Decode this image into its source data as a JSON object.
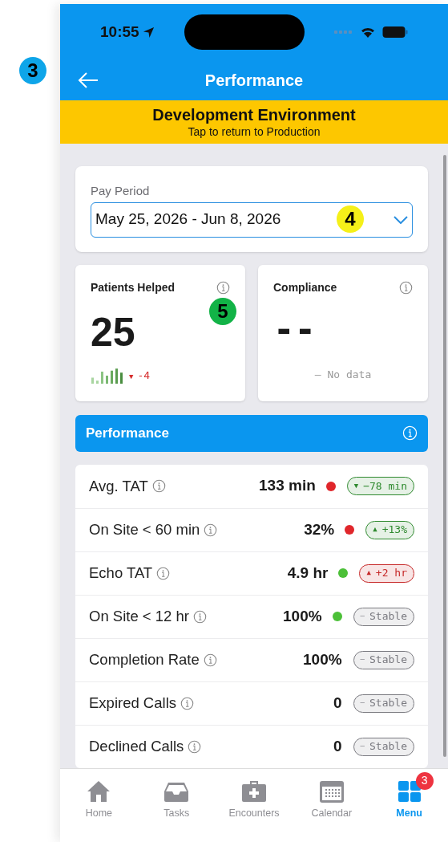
{
  "callouts": [
    {
      "label": "3",
      "color": "#0ea5e9"
    },
    {
      "label": "4",
      "color": "#f5f019"
    },
    {
      "label": "5",
      "color": "#12b347"
    }
  ],
  "status_bar": {
    "time": "10:55"
  },
  "header": {
    "title": "Performance"
  },
  "env_banner": {
    "title": "Development Environment",
    "subtitle": "Tap to return to Production"
  },
  "pay_period": {
    "label": "Pay Period",
    "value": "May 25, 2026 - Jun 8, 2026"
  },
  "stat_cards": [
    {
      "kind": "trend",
      "title": "Patients Helped",
      "value": "25",
      "change": "-4"
    },
    {
      "kind": "empty",
      "title": "Compliance",
      "value": "--",
      "note": "– No data"
    }
  ],
  "section": {
    "title": "Performance"
  },
  "metrics": [
    {
      "label": "Avg. TAT",
      "value": "133 min",
      "color": "#e0262b",
      "trend": {
        "color": "#2f8a2f",
        "arrow": "▼",
        "text": "−78 min"
      }
    },
    {
      "label": "On Site < 60 min",
      "value": "32%",
      "color": "#e0262b",
      "trend": {
        "color": "#2f8a2f",
        "arrow": "▲",
        "text": "+13%"
      }
    },
    {
      "label": "Echo TAT",
      "value": "4.9 hr",
      "color": "#4cc038",
      "trend": {
        "color": "#c62828",
        "arrow": "▲",
        "text": "+2 hr"
      }
    },
    {
      "label": "On Site < 12 hr",
      "value": "100%",
      "color": "#4cc038",
      "trend": {
        "color": "#7a7a80",
        "arrow": "–",
        "text": "Stable"
      }
    },
    {
      "label": "Completion Rate",
      "value": "100%",
      "trend": {
        "color": "#7a7a80",
        "arrow": "–",
        "text": "Stable"
      }
    },
    {
      "label": "Expired Calls",
      "value": "0",
      "trend": {
        "color": "#7a7a80",
        "arrow": "–",
        "text": "Stable"
      }
    },
    {
      "label": "Declined Calls",
      "value": "0",
      "trend": {
        "color": "#7a7a80",
        "arrow": "–",
        "text": "Stable"
      }
    }
  ],
  "tab_bar": [
    {
      "kind": "home",
      "label": "Home",
      "selected": false
    },
    {
      "kind": "tray",
      "label": "Tasks",
      "selected": false
    },
    {
      "kind": "medkit",
      "label": "Encounters",
      "selected": false
    },
    {
      "kind": "calendar",
      "label": "Calendar",
      "selected": false
    },
    {
      "kind": "grid",
      "label": "Menu",
      "selected": true,
      "badge": "3"
    }
  ]
}
